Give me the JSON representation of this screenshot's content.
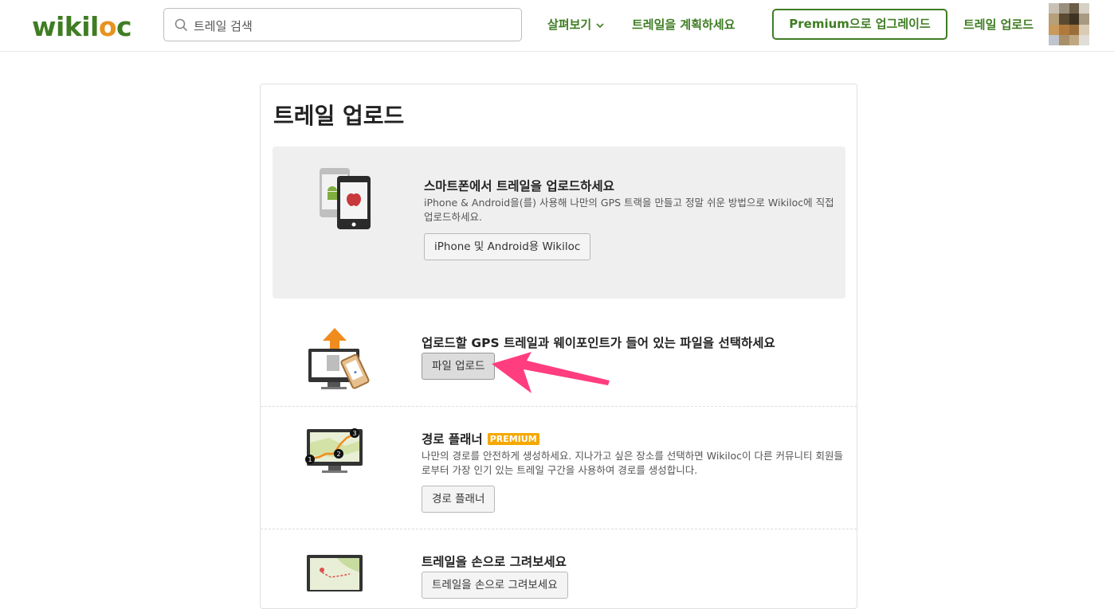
{
  "header": {
    "logo_text_a": "wikil",
    "logo_text_b": "c",
    "search_placeholder": "트레일 검색",
    "nav_browse": "살펴보기",
    "nav_plan": "트레일을 계획하세요",
    "premium_button": "Premium으로 업그레이드",
    "nav_upload": "트레일 업로드"
  },
  "page": {
    "title": "트레일 업로드",
    "sections": [
      {
        "title": "스마트폰에서 트레일을 업로드하세요",
        "description": "iPhone & Android을(를) 사용해 나만의 GPS 트랙을 만들고 정말 쉬운 방법으로 Wikiloc에 직접 업로드하세요.",
        "button": "iPhone 및 Android용 Wikiloc"
      },
      {
        "title": "업로드할 GPS 트레일과 웨이포인트가 들어 있는 파일을 선택하세요",
        "button": "파일 업로드"
      },
      {
        "title": "경로 플래너",
        "badge": "PREMIUM",
        "description": "나만의 경로를 안전하게 생성하세요. 지나가고 싶은 장소를 선택하면 Wikiloc이 다른 커뮤니티 회원들로부터 가장 인기 있는 트레일 구간을 사용하여 경로를 생성합니다.",
        "button": "경로 플래너"
      },
      {
        "title": "트레일을 손으로 그려보세요",
        "button": "트레일을 손으로 그려보세요"
      }
    ]
  },
  "icons": [
    "search-icon",
    "chevron-down-icon",
    "smartphones-icon",
    "file-upload-icon",
    "route-planner-icon",
    "draw-trail-icon",
    "annotation-arrow"
  ],
  "colors": {
    "brand": "#3f7d23",
    "accent": "#e8931f",
    "badge": "#f5a800",
    "arrow": "#ff3d7f"
  }
}
